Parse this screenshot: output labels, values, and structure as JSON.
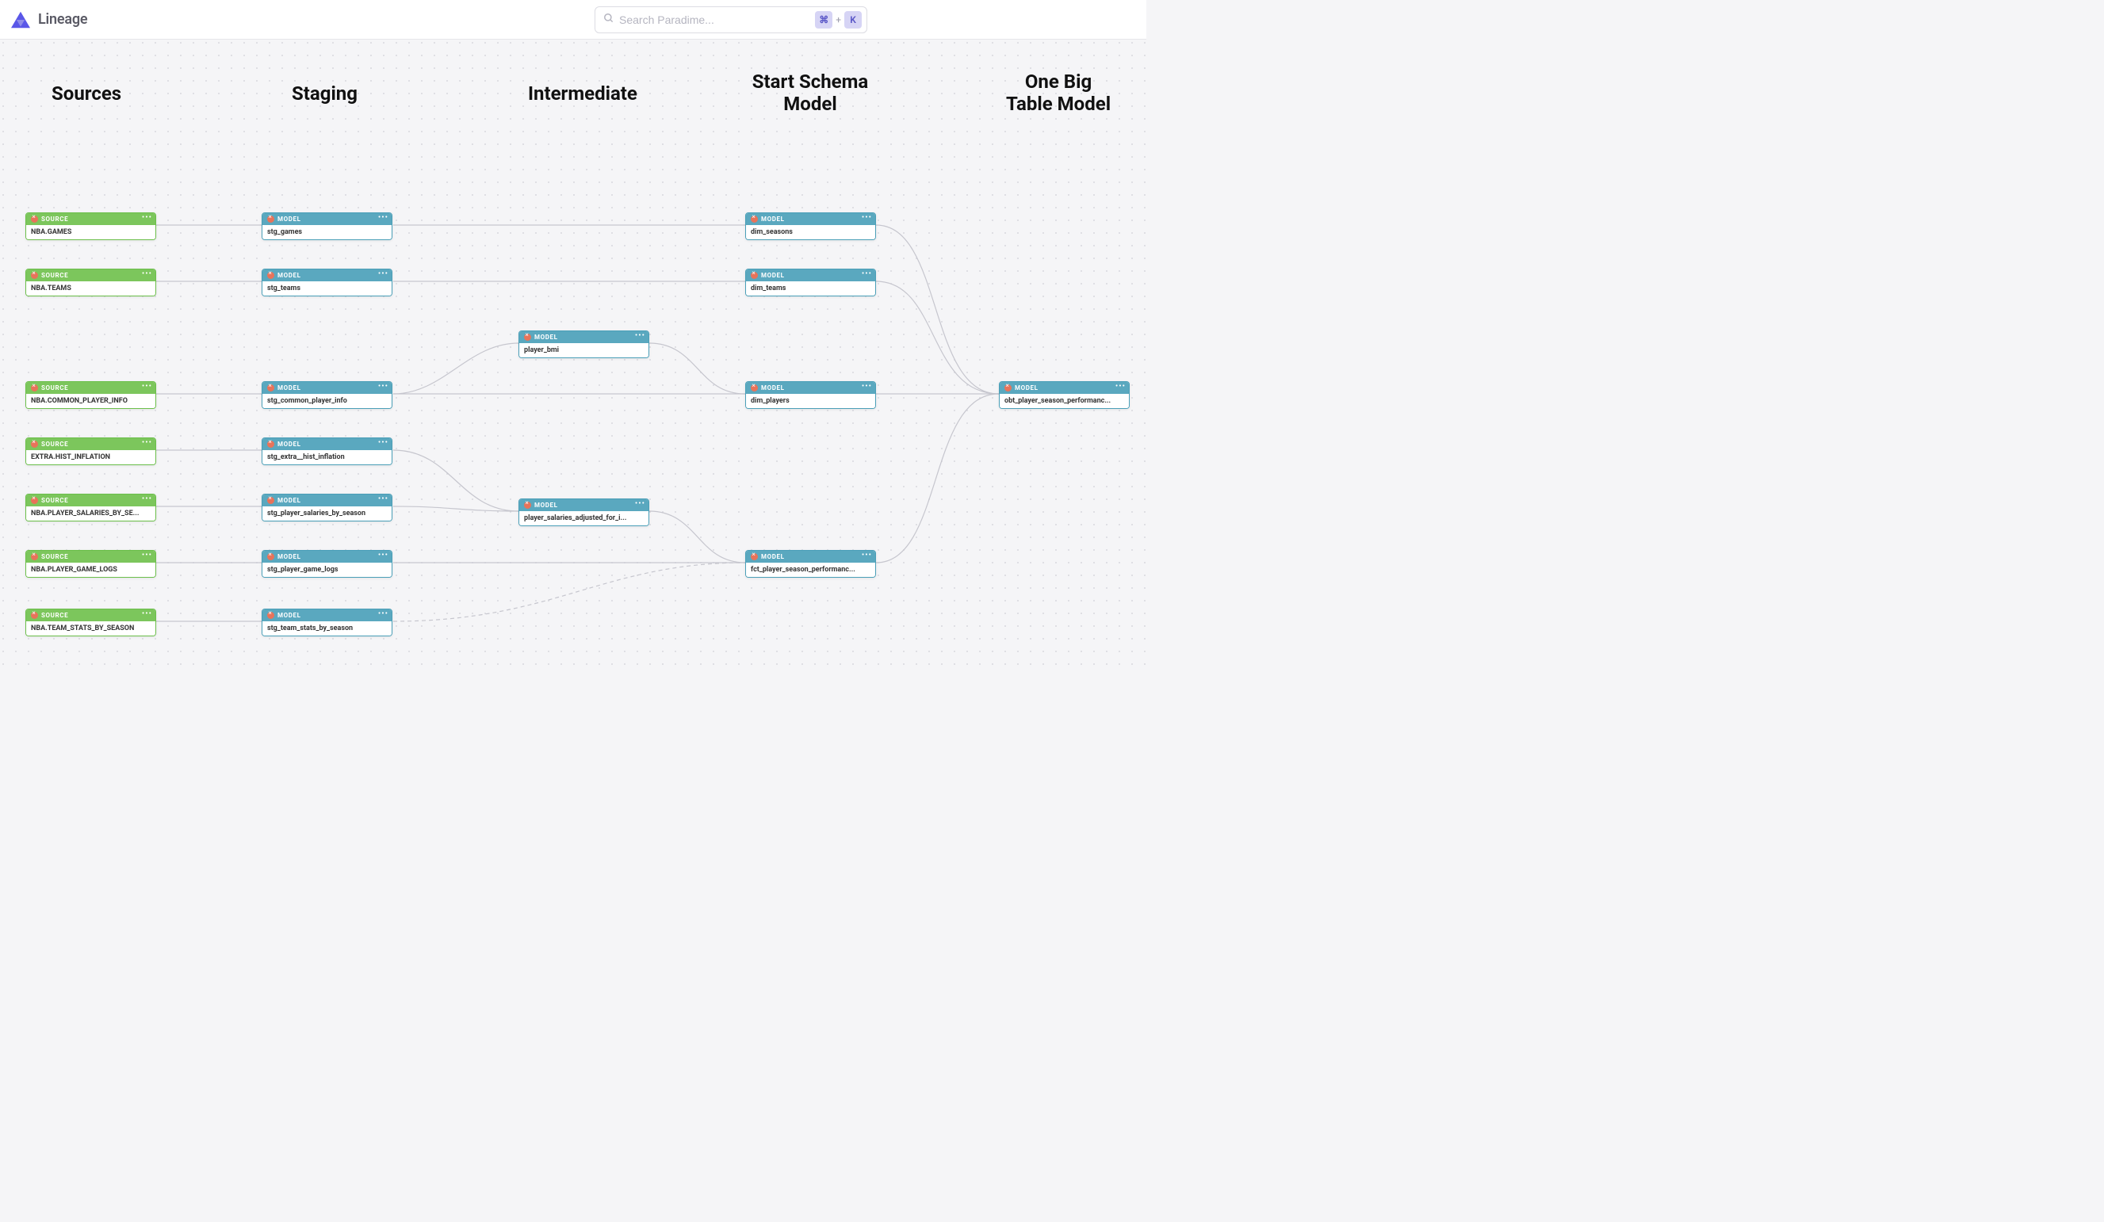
{
  "app": {
    "title": "Lineage"
  },
  "search": {
    "placeholder": "Search Paradime...",
    "kbd1": "⌘",
    "kbd_plus": "+",
    "kbd2": "K"
  },
  "columns": {
    "sources": "Sources",
    "staging": "Staging",
    "intermediate": "Intermediate",
    "star": "Start Schema\nModel",
    "obt": "One Big\nTable Model"
  },
  "labels": {
    "source_type": "SOURCE",
    "model_type": "MODEL",
    "menu": "•••"
  },
  "nodes": {
    "src_games": {
      "type": "SOURCE",
      "label": "NBA.GAMES"
    },
    "src_teams": {
      "type": "SOURCE",
      "label": "NBA.TEAMS"
    },
    "src_cpi": {
      "type": "SOURCE",
      "label": "NBA.COMMON_PLAYER_INFO"
    },
    "src_infl": {
      "type": "SOURCE",
      "label": "EXTRA.HIST_INFLATION"
    },
    "src_salaries": {
      "type": "SOURCE",
      "label": "NBA.PLAYER_SALARIES_BY_SE..."
    },
    "src_gamelogs": {
      "type": "SOURCE",
      "label": "NBA.PLAYER_GAME_LOGS"
    },
    "src_teamstats": {
      "type": "SOURCE",
      "label": "NBA.TEAM_STATS_BY_SEASON"
    },
    "stg_games": {
      "type": "MODEL",
      "label": "stg_games"
    },
    "stg_teams": {
      "type": "MODEL",
      "label": "stg_teams"
    },
    "stg_cpi": {
      "type": "MODEL",
      "label": "stg_common_player_info"
    },
    "stg_infl": {
      "type": "MODEL",
      "label": "stg_extra__hist_inflation"
    },
    "stg_salaries": {
      "type": "MODEL",
      "label": "stg_player_salaries_by_season"
    },
    "stg_gamelogs": {
      "type": "MODEL",
      "label": "stg_player_game_logs"
    },
    "stg_teamstats": {
      "type": "MODEL",
      "label": "stg_team_stats_by_season"
    },
    "int_bmi": {
      "type": "MODEL",
      "label": "player_bmi"
    },
    "int_sal_adj": {
      "type": "MODEL",
      "label": "player_salaries_adjusted_for_i..."
    },
    "dim_seasons": {
      "type": "MODEL",
      "label": "dim_seasons"
    },
    "dim_teams": {
      "type": "MODEL",
      "label": "dim_teams"
    },
    "dim_players": {
      "type": "MODEL",
      "label": "dim_players"
    },
    "fct_perf": {
      "type": "MODEL",
      "label": "fct_player_season_performanc..."
    },
    "obt": {
      "type": "MODEL",
      "label": "obt_player_season_performanc..."
    }
  }
}
